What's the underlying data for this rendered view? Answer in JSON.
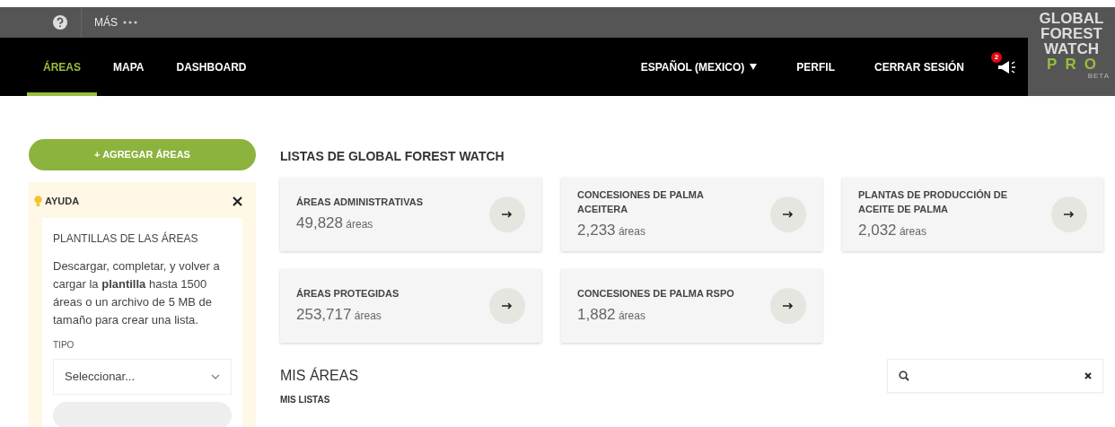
{
  "top_bar": {
    "more_label": "MÁS"
  },
  "nav": {
    "tabs": [
      {
        "label": "ÁREAS",
        "selected": true
      },
      {
        "label": "MAPA",
        "selected": false
      },
      {
        "label": "DASHBOARD",
        "selected": false
      }
    ],
    "language": "ESPAÑOL (MEXICO)",
    "links": [
      "PERFIL",
      "CERRAR SESIÓN"
    ],
    "notification_count": "2"
  },
  "logo": {
    "lines": [
      "GLOBAL",
      "FOREST",
      "WATCH"
    ],
    "pro": "PRO",
    "beta": "BETA"
  },
  "sidebar": {
    "add_button": "+ AGREGAR ÁREAS",
    "help": {
      "title": "AYUDA",
      "card_title": "PLANTILLAS DE LAS ÁREAS",
      "text": "Descargar, completar, y volver a cargar la **plantilla** hasta 1500 áreas o un archivo de 5 MB de tamaño para crear una lista.",
      "type_label": "TIPO",
      "type_placeholder": "Seleccionar..."
    }
  },
  "gfw_lists": {
    "title": "LISTAS DE GLOBAL FOREST WATCH",
    "cards": [
      {
        "title": "ÁREAS ADMINISTRATIVAS",
        "count": "49,828",
        "unit": "áreas"
      },
      {
        "title": "CONCESIONES DE PALMA ACEITERA",
        "count": "2,233",
        "unit": "áreas"
      },
      {
        "title": "PLANTAS DE PRODUCCIÓN DE ACEITE DE PALMA",
        "count": "2,032",
        "unit": "áreas"
      },
      {
        "title": "ÁREAS PROTEGIDAS",
        "count": "253,717",
        "unit": "áreas"
      },
      {
        "title": "CONCESIONES DE PALMA RSPO",
        "count": "1,882",
        "unit": "áreas"
      }
    ]
  },
  "my_areas": {
    "title": "MIS ÁREAS",
    "subtitle": "MIS LISTAS"
  }
}
